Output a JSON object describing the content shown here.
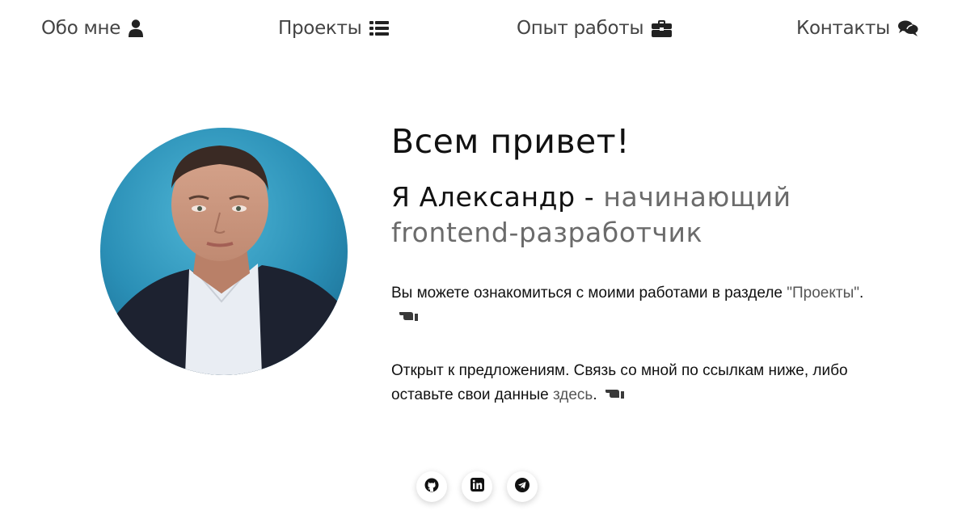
{
  "nav": {
    "items": [
      {
        "label": "Обо мне",
        "icon": "user-icon"
      },
      {
        "label": "Проекты",
        "icon": "list-icon"
      },
      {
        "label": "Опыт работы",
        "icon": "briefcase-icon"
      },
      {
        "label": "Контакты",
        "icon": "chat-bubbles-icon"
      }
    ]
  },
  "hero": {
    "greeting": "Всем привет!",
    "name_part": "Я Александр - ",
    "role_part": "начинающий frontend-разработчик",
    "para1_text": "Вы можете ознакомиться с моими работами в разделе ",
    "para1_link": "\"Проекты\"",
    "para1_end": ".",
    "para2_text": "Открыт к предложениям. Связь со мной по ссылкам ниже, либо оставьте свои данные ",
    "para2_link": "здесь",
    "para2_end": "."
  },
  "avatar": {
    "alt": "portrait-photo",
    "bg_color": "#2f97bf"
  },
  "socials": [
    {
      "icon": "github-icon"
    },
    {
      "icon": "linkedin-icon"
    },
    {
      "icon": "telegram-icon"
    }
  ],
  "colors": {
    "text": "#111111",
    "muted": "#6b6b6b",
    "nav": "#444444"
  }
}
